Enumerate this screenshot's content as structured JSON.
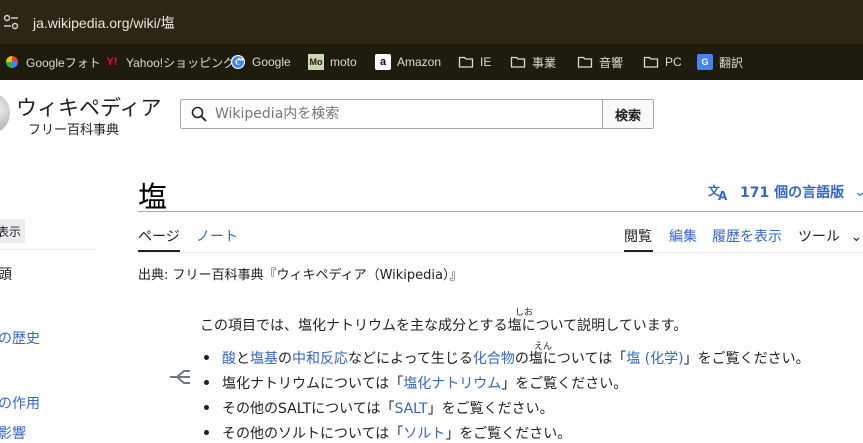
{
  "browser": {
    "url": "ja.wikipedia.org/wiki/塩",
    "bookmarks": [
      {
        "label": "Googleフォト",
        "icon": "google-photos-icon"
      },
      {
        "label": "Yahoo!ショッピング",
        "icon": "yahoo-icon"
      },
      {
        "label": "Google",
        "icon": "google-icon"
      },
      {
        "label": "moto",
        "icon": "moto-icon"
      },
      {
        "label": "Amazon",
        "icon": "amazon-icon"
      },
      {
        "label": "IE",
        "icon": "folder-icon"
      },
      {
        "label": "事業",
        "icon": "folder-icon"
      },
      {
        "label": "音響",
        "icon": "folder-icon"
      },
      {
        "label": "PC",
        "icon": "folder-icon"
      },
      {
        "label": "翻訳",
        "icon": "translate-icon"
      }
    ]
  },
  "wiki": {
    "logo_title": "ウィキペディア",
    "logo_tagline": "フリー百科事典",
    "search_placeholder": "Wikipedia内を検索",
    "search_button": "検索"
  },
  "sidebar": {
    "hide_label": "表示",
    "items": [
      {
        "label": "頭"
      },
      {
        "label": "の歴史"
      },
      {
        "label": "の作用"
      },
      {
        "label": "影響"
      }
    ]
  },
  "article": {
    "title": "塩",
    "languages": "171 個の言語版",
    "tabs_left": [
      {
        "label": "ページ"
      },
      {
        "label": "ノート"
      }
    ],
    "tabs_right": [
      {
        "label": "閲覧"
      },
      {
        "label": "編集"
      },
      {
        "label": "履歴を表示"
      },
      {
        "label": "ツール"
      }
    ],
    "from": "出典: フリー百科事典『ウィキペディア（Wikipedia）』",
    "hatnote": {
      "intro": "この項目では、塩化ナトリウムを主な成分とする塩について説明しています。",
      "ruby_shio": "しお",
      "ruby_en": "えん",
      "b1": {
        "l1": "酸",
        "t1": "と",
        "l2": "塩基",
        "t2": "の",
        "l3": "中和反応",
        "t3": "などによって生じる",
        "l4": "化合物",
        "t4": "の塩については「",
        "l5": "塩 (化学)",
        "t5": "」をご覧ください。"
      },
      "b2": {
        "t1": "塩化ナトリウムについては「",
        "l1": "塩化ナトリウム",
        "t2": "」をご覧ください。"
      },
      "b3": {
        "t1": "その他のSALTについては「",
        "l1": "SALT",
        "t2": "」をご覧ください。"
      },
      "b4": {
        "t1": "その他のソルトについては「",
        "l1": "ソルト",
        "t2": "」をご覧ください。"
      }
    }
  },
  "colors": {
    "link": "#3366cc",
    "text": "#202122",
    "urlbar": "#2b2712",
    "bookmarks_bar": "#1f1c0d"
  }
}
